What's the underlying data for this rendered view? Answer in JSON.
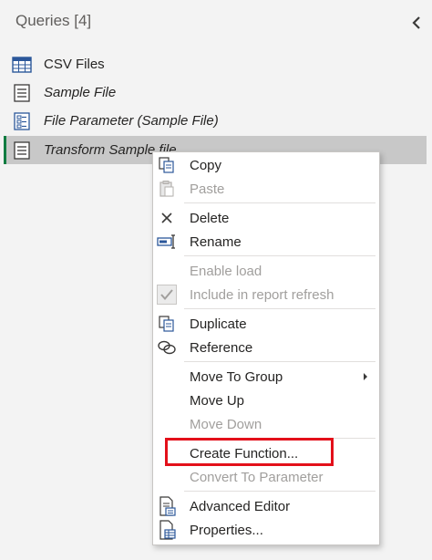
{
  "panel": {
    "title": "Queries [4]"
  },
  "queries": [
    {
      "label": "CSV Files",
      "icon": "table-icon",
      "italic": false,
      "selected": false
    },
    {
      "label": "Sample File",
      "icon": "document-icon",
      "italic": true,
      "selected": false
    },
    {
      "label": "File Parameter (Sample File)",
      "icon": "parameter-icon",
      "italic": true,
      "selected": false
    },
    {
      "label": "Transform Sample file",
      "icon": "document-icon",
      "italic": true,
      "selected": true
    }
  ],
  "context_menu": {
    "items": [
      {
        "label": "Copy",
        "icon": "copy-icon",
        "enabled": true
      },
      {
        "label": "Paste",
        "icon": "paste-icon",
        "enabled": false
      },
      {
        "label": "Delete",
        "icon": "delete-icon",
        "enabled": true
      },
      {
        "label": "Rename",
        "icon": "rename-icon",
        "enabled": true
      },
      {
        "label": "Enable load",
        "icon": null,
        "enabled": false
      },
      {
        "label": "Include in report refresh",
        "icon": "checkmark-icon",
        "enabled": false
      },
      {
        "label": "Duplicate",
        "icon": "duplicate-icon",
        "enabled": true
      },
      {
        "label": "Reference",
        "icon": "reference-icon",
        "enabled": true
      },
      {
        "label": "Move To Group",
        "icon": null,
        "enabled": true,
        "submenu": true
      },
      {
        "label": "Move Up",
        "icon": null,
        "enabled": true
      },
      {
        "label": "Move Down",
        "icon": null,
        "enabled": false
      },
      {
        "label": "Create Function...",
        "icon": null,
        "enabled": true,
        "highlighted": true
      },
      {
        "label": "Convert To Parameter",
        "icon": null,
        "enabled": false
      },
      {
        "label": "Advanced Editor",
        "icon": "advanced-editor-icon",
        "enabled": true
      },
      {
        "label": "Properties...",
        "icon": "properties-icon",
        "enabled": true
      }
    ]
  },
  "colors": {
    "selected_accent": "#107c41",
    "highlight_border": "#e3101a",
    "icon_blue": "#2b579a"
  }
}
